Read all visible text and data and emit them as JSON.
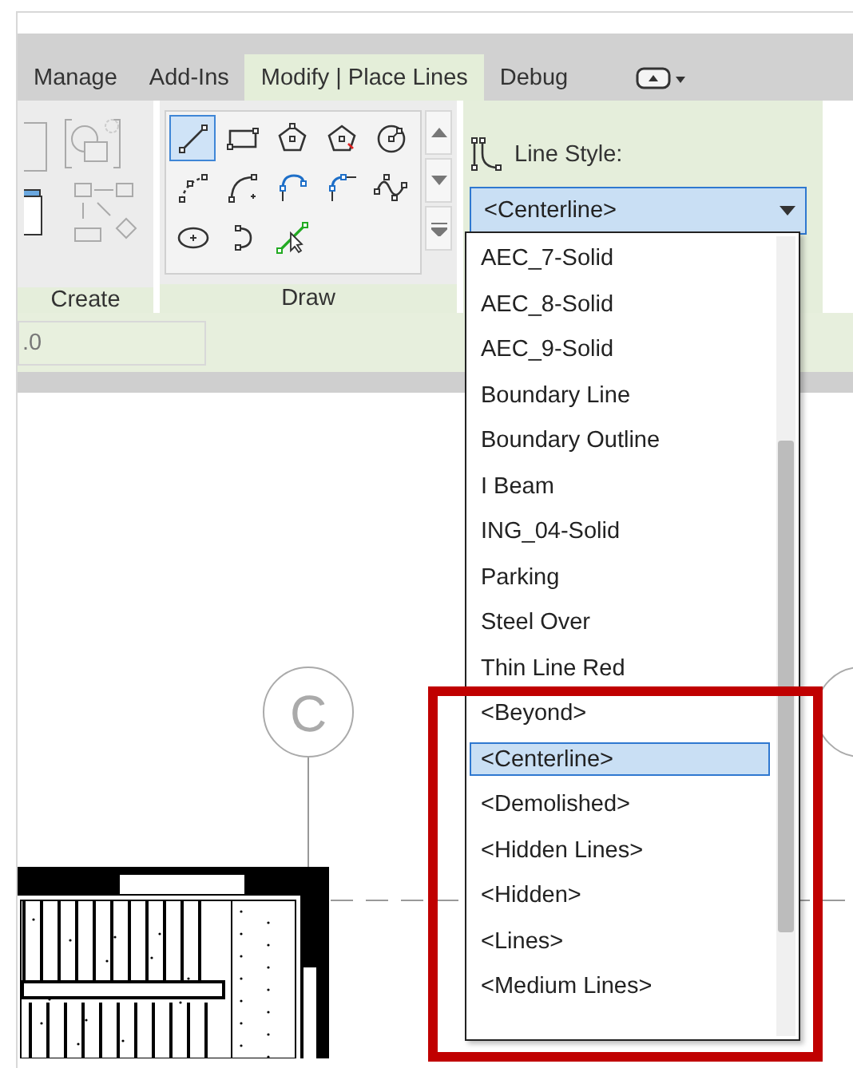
{
  "tabs": [
    {
      "label": "Manage",
      "selected": false
    },
    {
      "label": "Add-Ins",
      "selected": false
    },
    {
      "label": "Modify | Place Lines",
      "selected": true
    },
    {
      "label": "Debug",
      "selected": false
    }
  ],
  "ribbon": {
    "create_panel": {
      "label": "Create"
    },
    "draw_panel": {
      "label": "Draw",
      "tools": [
        {
          "kind": "line",
          "selected": true
        },
        {
          "kind": "rectangle",
          "selected": false
        },
        {
          "kind": "inscribed",
          "selected": false
        },
        {
          "kind": "circumscribed",
          "selected": false
        },
        {
          "kind": "circle",
          "selected": false
        },
        {
          "kind": "startarc",
          "selected": false
        },
        {
          "kind": "centerarc",
          "selected": false
        },
        {
          "kind": "tangentarc",
          "selected": false
        },
        {
          "kind": "fillet",
          "selected": false
        },
        {
          "kind": "spline",
          "selected": false
        },
        {
          "kind": "ellipse",
          "selected": false
        },
        {
          "kind": "partialellipse",
          "selected": false
        },
        {
          "kind": "picklines",
          "selected": false
        }
      ]
    },
    "line_style": {
      "label": "Line Style:",
      "value": "<Centerline>",
      "options": [
        {
          "label": "AEC_7-Solid",
          "selected": false
        },
        {
          "label": "AEC_8-Solid",
          "selected": false
        },
        {
          "label": "AEC_9-Solid",
          "selected": false
        },
        {
          "label": "Boundary Line",
          "selected": false
        },
        {
          "label": "Boundary Outline",
          "selected": false
        },
        {
          "label": "I Beam",
          "selected": false
        },
        {
          "label": "ING_04-Solid",
          "selected": false
        },
        {
          "label": "Parking",
          "selected": false
        },
        {
          "label": "Steel Over",
          "selected": false
        },
        {
          "label": "Thin Line Red",
          "selected": false
        },
        {
          "label": "<Beyond>",
          "selected": false
        },
        {
          "label": "<Centerline>",
          "selected": true
        },
        {
          "label": "<Demolished>",
          "selected": false
        },
        {
          "label": "<Hidden Lines>",
          "selected": false
        },
        {
          "label": "<Hidden>",
          "selected": false
        },
        {
          "label": "<Lines>",
          "selected": false
        },
        {
          "label": "<Medium Lines>",
          "selected": false
        }
      ]
    }
  },
  "options_bar": {
    "field_value": ".0"
  },
  "canvas": {
    "grid_bubbles": [
      {
        "label": "C"
      }
    ]
  }
}
